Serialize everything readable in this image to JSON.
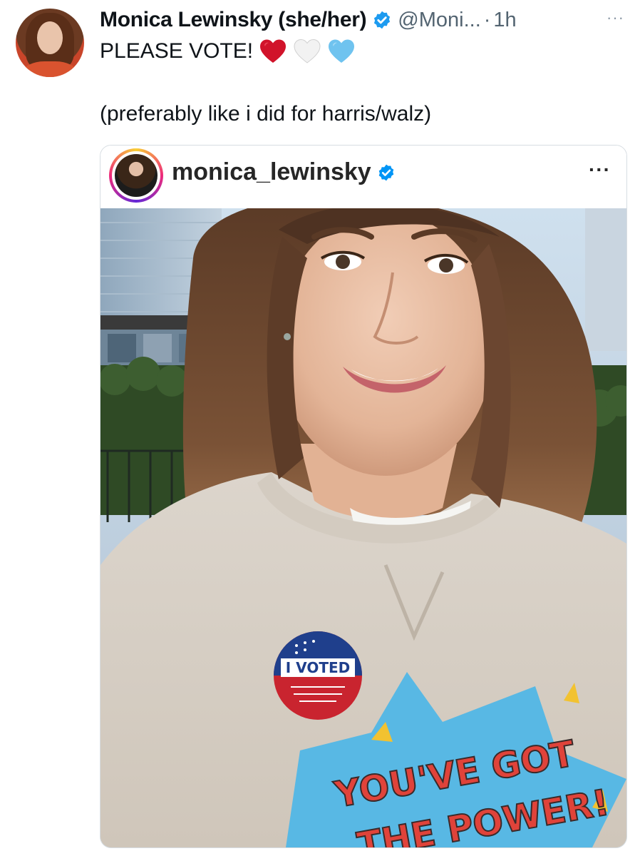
{
  "tweet": {
    "display_name": "Monica Lewinsky (she/her)",
    "handle": "@Moni...",
    "separator": "·",
    "time": "1h",
    "more_label": "···",
    "text_line1": "PLEASE VOTE!",
    "text_line2": "(preferably like i did for harris/walz)",
    "hearts": [
      "red-heart-icon",
      "white-heart-icon",
      "light-blue-heart-icon"
    ]
  },
  "instagram_card": {
    "username": "monica_lewinsky",
    "more_label": "···",
    "photo": {
      "sticker_text": "I VOTED",
      "sweatshirt_text_line1": "YOU'VE GOT",
      "sweatshirt_text_line2": "THE POWER!"
    }
  },
  "colors": {
    "verified_blue": "#1d9bf0",
    "text_primary": "#0f1419",
    "text_secondary": "#536471",
    "card_border": "#d7dde2"
  }
}
